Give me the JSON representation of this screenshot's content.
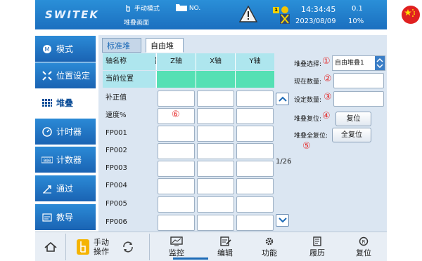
{
  "header": {
    "logo": "SWITEK",
    "mode": "手动模式",
    "screen": "堆叠画面",
    "program_no": "NO.",
    "time": "14:34:45",
    "date": "2023/08/09",
    "speed": "0.1",
    "speed_pct": "10%",
    "worker_badge": "1",
    "icons": [
      "hand-icon",
      "folder-icon",
      "warning-icon",
      "worker-icon",
      "china-flag-icon"
    ]
  },
  "nav": {
    "items": [
      {
        "label": "模式",
        "icon": "mode-icon"
      },
      {
        "label": "位置设定",
        "icon": "position-icon"
      },
      {
        "label": "堆叠",
        "icon": "stack-grid-icon",
        "active": true
      },
      {
        "label": "计时器",
        "icon": "timer-icon"
      },
      {
        "label": "计数器",
        "icon": "counter-icon"
      },
      {
        "label": "通过",
        "icon": "pass-icon"
      },
      {
        "label": "教导",
        "icon": "teach-icon"
      }
    ]
  },
  "tabs": [
    "标准堆叠",
    "自由堆叠"
  ],
  "table": {
    "col_name": "轴名称",
    "axes": [
      "Z轴",
      "X轴",
      "Y轴"
    ],
    "current_pos_label": "当前位置",
    "compensation_label": "补正值",
    "speed_label": "速度%",
    "rows": [
      "FP001",
      "FP002",
      "FP003",
      "FP004",
      "FP005",
      "FP006"
    ],
    "page": "1/26"
  },
  "right": {
    "stack_select_label": "堆叠选择:",
    "stack_select_value": "自由堆叠1",
    "current_count_label": "现在数量:",
    "set_count_label": "设定数量:",
    "stack_reset_label": "堆叠复位:",
    "stack_reset_button": "复位",
    "stack_all_reset_label": "堆叠全复位:",
    "stack_all_reset_button": "全复位"
  },
  "markers": [
    "①",
    "②",
    "③",
    "④",
    "⑤",
    "⑥"
  ],
  "bottom": {
    "manual_op": "手动",
    "manual_op2": "操作",
    "items": [
      {
        "label": "监控",
        "icon": "monitor-icon"
      },
      {
        "label": "编辑",
        "icon": "edit-icon",
        "active": true
      },
      {
        "label": "功能",
        "icon": "gear-icon"
      },
      {
        "label": "履历",
        "icon": "history-icon"
      },
      {
        "label": "复位",
        "icon": "reset-icon"
      }
    ]
  },
  "colors": {
    "accent": "#1b6fbf",
    "header_cell": "#aee6ee",
    "current_cell": "#55e0b4",
    "marker": "#e53030"
  }
}
